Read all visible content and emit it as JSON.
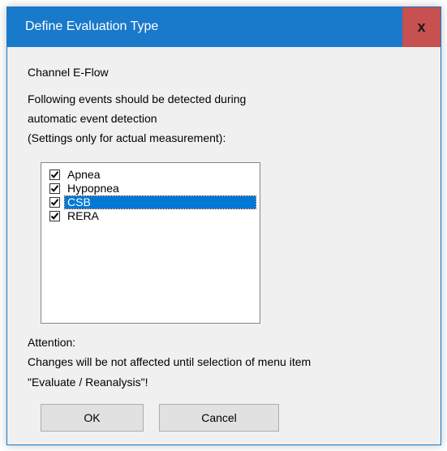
{
  "window": {
    "title": "Define Evaluation Type",
    "close_glyph": "x",
    "title_bar_color": "#1979ca",
    "close_button_color": "#c75050"
  },
  "content": {
    "channel_label": "Channel E-Flow",
    "description_line1": "Following events should be detected during",
    "description_line2": "automatic event detection",
    "description_line3": "(Settings only for actual measurement):",
    "attention_label": "Attention:",
    "attention_line1": "Changes will be not affected until selection of menu item",
    "attention_line2": "\"Evaluate / Reanalysis\"!"
  },
  "events": [
    {
      "label": "Apnea",
      "checked": true,
      "selected": false
    },
    {
      "label": "Hypopnea",
      "checked": true,
      "selected": false
    },
    {
      "label": "CSB",
      "checked": true,
      "selected": true
    },
    {
      "label": "RERA",
      "checked": true,
      "selected": false
    }
  ],
  "buttons": {
    "ok_label": "OK",
    "cancel_label": "Cancel"
  },
  "colors": {
    "selection": "#0078d7"
  }
}
